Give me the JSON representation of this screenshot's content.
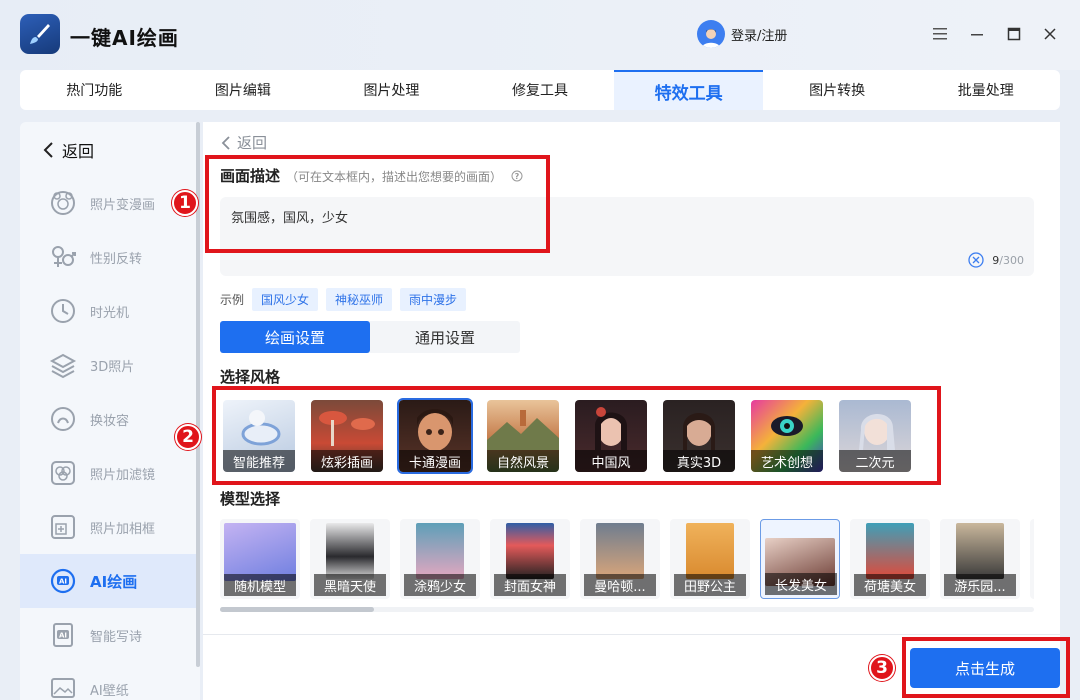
{
  "app": {
    "title": "一键AI绘画",
    "login_label": "登录/注册"
  },
  "tabs": [
    {
      "label": "热门功能",
      "active": false
    },
    {
      "label": "图片编辑",
      "active": false
    },
    {
      "label": "图片处理",
      "active": false
    },
    {
      "label": "修复工具",
      "active": false
    },
    {
      "label": "特效工具",
      "active": true
    },
    {
      "label": "图片转换",
      "active": false
    },
    {
      "label": "批量处理",
      "active": false
    }
  ],
  "sidebar": {
    "back_label": "返回",
    "items": [
      {
        "label": "照片变漫画",
        "icon": "face-cartoon-icon"
      },
      {
        "label": "性别反转",
        "icon": "gender-icon"
      },
      {
        "label": "时光机",
        "icon": "clock-icon"
      },
      {
        "label": "3D照片",
        "icon": "layers-icon"
      },
      {
        "label": "换妆容",
        "icon": "makeup-icon"
      },
      {
        "label": "照片加滤镜",
        "icon": "filter-icon"
      },
      {
        "label": "照片加相框",
        "icon": "frame-icon"
      },
      {
        "label": "AI绘画",
        "icon": "ai-paint-icon",
        "active": true
      },
      {
        "label": "智能写诗",
        "icon": "ai-poem-icon"
      },
      {
        "label": "AI壁纸",
        "icon": "ai-wallpaper-icon"
      }
    ]
  },
  "main": {
    "back_label": "返回",
    "description": {
      "title": "画面描述",
      "hint": "（可在文本框内，描述出您想要的画面）",
      "value": "氛围感，国风，少女",
      "count": "9",
      "max": "/300"
    },
    "examples": {
      "label": "示例",
      "chips": [
        "国风少女",
        "神秘巫师",
        "雨中漫步"
      ]
    },
    "settings_tabs": [
      {
        "label": "绘画设置",
        "active": true
      },
      {
        "label": "通用设置",
        "active": false
      }
    ],
    "style_title": "选择风格",
    "styles": [
      {
        "label": "智能推荐",
        "colors": [
          "#dfe9f6",
          "#9fb6d4"
        ]
      },
      {
        "label": "炫彩插画",
        "colors": [
          "#c94a35",
          "#6d4a3a"
        ]
      },
      {
        "label": "卡通漫画",
        "colors": [
          "#3a2620",
          "#c77a55"
        ],
        "selected": true
      },
      {
        "label": "自然风景",
        "colors": [
          "#d9a06b",
          "#5b6f3c"
        ]
      },
      {
        "label": "中国风",
        "colors": [
          "#2b1a1c",
          "#c9786c"
        ]
      },
      {
        "label": "真实3D",
        "colors": [
          "#2a2424",
          "#c29a86"
        ]
      },
      {
        "label": "艺术创想",
        "colors": [
          "#d23aa6",
          "#2c9c3a"
        ]
      },
      {
        "label": "二次元",
        "colors": [
          "#a9bcd6",
          "#e8d8d0"
        ]
      }
    ],
    "model_title": "模型选择",
    "models": [
      {
        "label": "随机模型",
        "colors": [
          "#a58be0",
          "#5b7fd8"
        ]
      },
      {
        "label": "黑暗天使",
        "colors": [
          "#e9e9ea",
          "#2a2a2e"
        ]
      },
      {
        "label": "涂鸦少女",
        "colors": [
          "#5e9fb8",
          "#e4a7c0"
        ]
      },
      {
        "label": "封面女神",
        "colors": [
          "#2f5ea6",
          "#e45a5a"
        ]
      },
      {
        "label": "曼哈顿...",
        "colors": [
          "#6f7d8f",
          "#d9a57a"
        ]
      },
      {
        "label": "田野公主",
        "colors": [
          "#f0b25b",
          "#d98a2f"
        ]
      },
      {
        "label": "长发美女",
        "colors": [
          "#d9b9ae",
          "#6b3b33"
        ],
        "selected": true
      },
      {
        "label": "荷塘美女",
        "colors": [
          "#3f9fb8",
          "#e04a3a"
        ]
      },
      {
        "label": "游乐园...",
        "colors": [
          "#c9b79c",
          "#3a3a3a"
        ]
      }
    ],
    "generate_label": "点击生成"
  },
  "annotations": [
    "1",
    "2",
    "3"
  ],
  "colors": {
    "accent": "#1e6ff0",
    "annotation": "#e0151b"
  }
}
